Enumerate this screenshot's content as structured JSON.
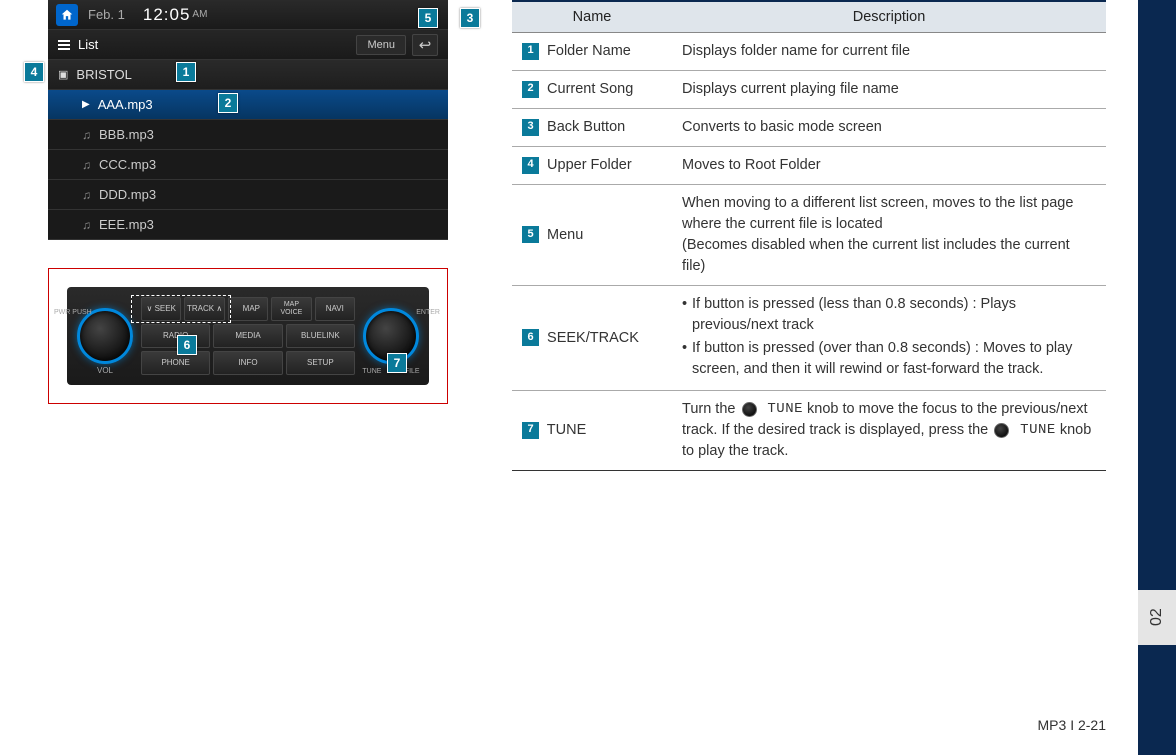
{
  "side_tab": "02",
  "screen": {
    "date": "Feb.   1",
    "time": "12:05",
    "ampm": "AM",
    "list_label": "List",
    "menu_label": "Menu",
    "folder": "BRISTOL",
    "songs": [
      {
        "name": "AAA.mp3",
        "current": true
      },
      {
        "name": "BBB.mp3",
        "current": false
      },
      {
        "name": "CCC.mp3",
        "current": false
      },
      {
        "name": "DDD.mp3",
        "current": false
      },
      {
        "name": "EEE.mp3",
        "current": false
      }
    ]
  },
  "panel": {
    "left_knob_top": "PWR\nPUSH",
    "left_knob_bot": "VOL",
    "right_knob_top": "ENTER",
    "right_knob_bot": "TUNE            FILE",
    "buttons": [
      "∨ SEEK",
      "TRACK ∧",
      "   MAP",
      "MAP\nVOICE",
      "NAVI",
      "RADIO",
      "MEDIA",
      "BLUELINK",
      "PHONE",
      "INFO",
      "SETUP"
    ]
  },
  "table": {
    "headers": {
      "name": "Name",
      "desc": "Description"
    },
    "rows": [
      {
        "num": "1",
        "name": "Folder Name",
        "desc": "Displays folder name for current file"
      },
      {
        "num": "2",
        "name": "Current Song",
        "desc": "Displays current playing file name"
      },
      {
        "num": "3",
        "name": "Back Button",
        "desc": "Converts to basic mode screen"
      },
      {
        "num": "4",
        "name": "Upper Folder",
        "desc": "Moves to Root Folder"
      },
      {
        "num": "5",
        "name": "Menu",
        "desc": "When moving to a different list screen, moves to the list page where the current file is located\n(Becomes disabled when the current list includes the current file)"
      },
      {
        "num": "6",
        "name": "SEEK/TRACK",
        "desc_bullets": [
          "If button is pressed (less than 0.8 seconds) : Plays previous/next track",
          "If button is pressed (over than 0.8 seconds) : Moves to play screen, and then it will rewind or fast-forward the track."
        ]
      },
      {
        "num": "7",
        "name": "TUNE",
        "desc_tune": {
          "part1": "Turn the ",
          "tune1": " TUNE",
          "part2": " knob to move the focus to the previous/next track. If the desired track is displayed, press the ",
          "tune2": " TUNE",
          "part3": " knob to play the track."
        }
      }
    ]
  },
  "footer": "MP3 I 2-21"
}
